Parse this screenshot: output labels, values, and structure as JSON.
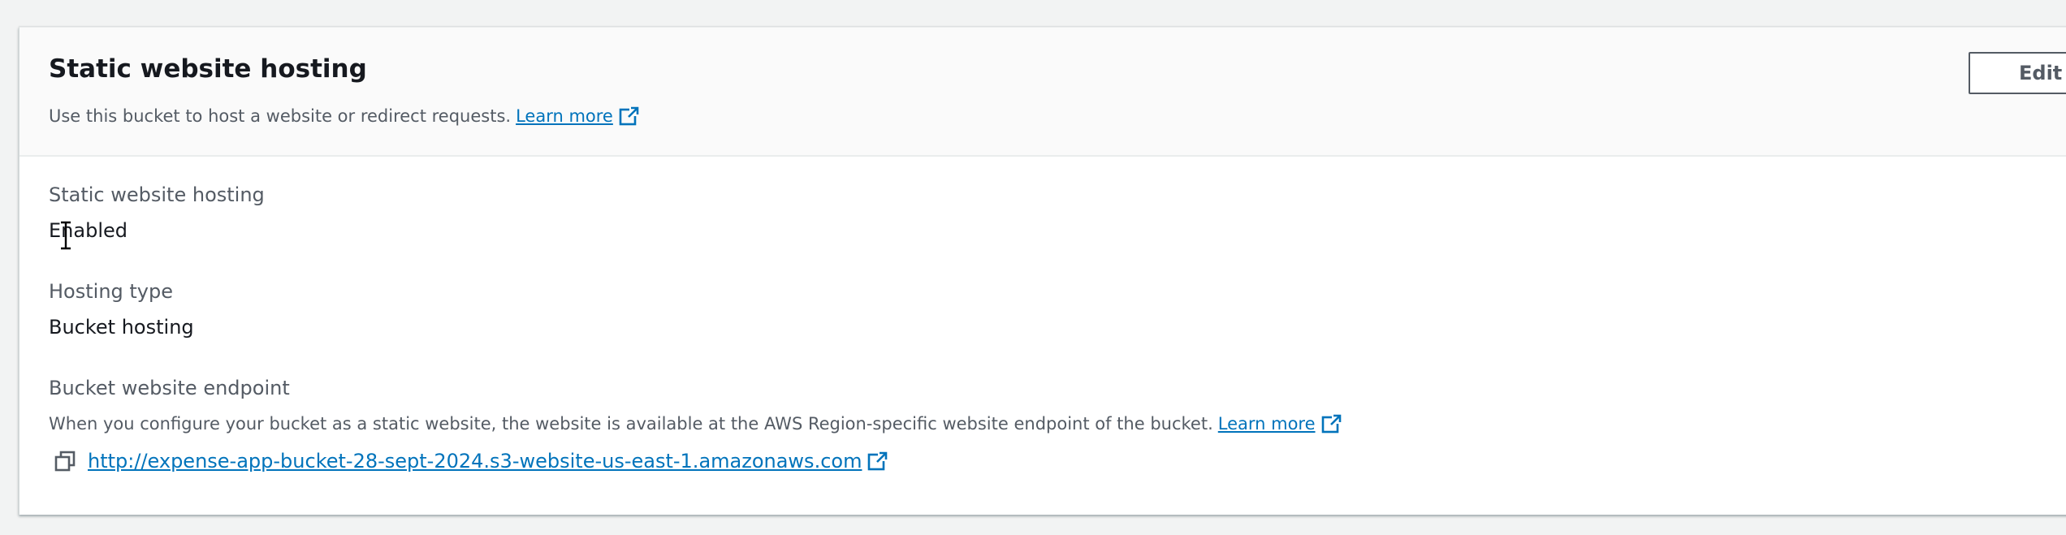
{
  "header": {
    "title": "Static website hosting",
    "description": "Use this bucket to host a website or redirect requests.",
    "learn_more": "Learn more",
    "edit_label": "Edit"
  },
  "fields": {
    "hosting_label": "Static website hosting",
    "hosting_value": "Enabled",
    "type_label": "Hosting type",
    "type_value": "Bucket hosting",
    "endpoint_label": "Bucket website endpoint",
    "endpoint_description": "When you configure your bucket as a static website, the website is available at the AWS Region-specific website endpoint of the bucket.",
    "endpoint_learn_more": "Learn more",
    "endpoint_url": "http://expense-app-bucket-28-sept-2024.s3-website-us-east-1.amazonaws.com"
  },
  "icons": {
    "external_link": "external-link-icon",
    "copy": "copy-icon",
    "text_cursor": "text-cursor-icon"
  },
  "colors": {
    "link": "#0073bb",
    "text": "#16191f",
    "muted": "#545b64",
    "header_bg": "#fafafa",
    "page_bg": "#f2f3f3"
  }
}
